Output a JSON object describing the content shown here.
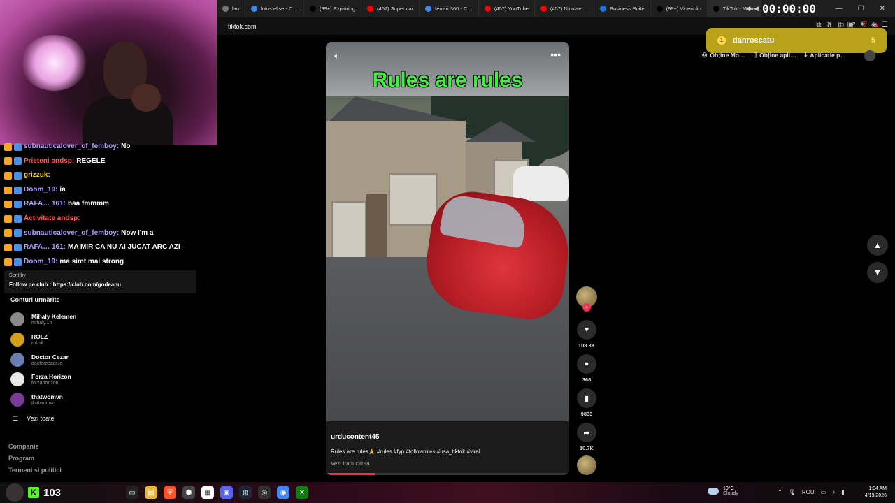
{
  "browser": {
    "tabs": [
      {
        "label": "lan",
        "color": "#777"
      },
      {
        "label": "lotus elise - C…",
        "color": "#4285f4"
      },
      {
        "label": "(99+) Exploring",
        "color": "#000"
      },
      {
        "label": "(457) Super car",
        "color": "#ff0000"
      },
      {
        "label": "ferrari 360 - C…",
        "color": "#4285f4"
      },
      {
        "label": "(457) YouTube",
        "color": "#ff0000"
      },
      {
        "label": "(457) Nicolae …",
        "color": "#ff0000"
      },
      {
        "label": "Business Suite",
        "color": "#1877f2"
      },
      {
        "label": "(99+) Videoclip",
        "color": "#000"
      },
      {
        "label": "TikTok - Make",
        "color": "#000"
      }
    ],
    "timer": "00:00:00",
    "url": "tiktok.com"
  },
  "chat": {
    "messages": [
      {
        "user": "subnauticalover_of_femboy:",
        "text": "No",
        "color": "default"
      },
      {
        "user": "Prieteni andsp:",
        "text": "REGELE",
        "color": "red"
      },
      {
        "user": "grizzuk:",
        "text": "",
        "color": "gold"
      },
      {
        "user": "Doom_19:",
        "text": "ia",
        "color": "default"
      },
      {
        "user": "RAFA… 161:",
        "text": "baa fmmmm",
        "color": "default"
      },
      {
        "user": "Activitate andsp:",
        "text": "",
        "color": "red"
      },
      {
        "user": "subnauticalover_of_femboy:",
        "text": "Now I'm a",
        "color": "default"
      },
      {
        "user": "RAFA… 161:",
        "text": "MA MIR CA NU AI JUCAT ARC AZI",
        "color": "default"
      },
      {
        "user": "Doom_19:",
        "text": "ma simt mai strong",
        "color": "default"
      }
    ],
    "sent_by": "Sent by",
    "follow_text": "Follow pe club : https://club.com/godeanu"
  },
  "sidebar": {
    "title": "Conturi urmărite",
    "accounts": [
      {
        "name": "Mihaly Kelemen",
        "handle": "mihaly.14",
        "color": "#8a8a8a"
      },
      {
        "name": "ROLZ",
        "handle": "rolzul",
        "color": "#d4a017"
      },
      {
        "name": "Doctor Cezar",
        "handle": "doctorcezar.ro",
        "color": "#6a7fb0"
      },
      {
        "name": "Forza Horizon",
        "handle": "forzahorizon",
        "color": "#e8e8e8"
      },
      {
        "name": "thatwomvn",
        "handle": "thatwomvn",
        "color": "#7a3a9a"
      }
    ],
    "see_all": "Vezi toate",
    "footer": [
      "Companie",
      "Program",
      "Termeni și politici"
    ]
  },
  "video": {
    "title_overlay": "Rules are rules",
    "username": "urducontent45",
    "caption": "Rules are rules🙏 #rules #fyp #followrules #usa_tiktok #viral",
    "translate": "Vezi traducerea",
    "progress": 0.2
  },
  "actions": {
    "likes": "108.3K",
    "comments": "368",
    "saves": "9833",
    "shares": "10.7K"
  },
  "notification": {
    "name": "danroscatu",
    "count": "5",
    "coin": "1"
  },
  "top_actions": [
    "Obține Mo…",
    "Obține apli…",
    "Aplicație p…"
  ],
  "taskbar": {
    "viewer_count": "103",
    "weather_temp": "10°C",
    "weather_desc": "Cloudy",
    "lang": "ROU",
    "time": "1:04 AM",
    "date": "4/19/2026"
  }
}
